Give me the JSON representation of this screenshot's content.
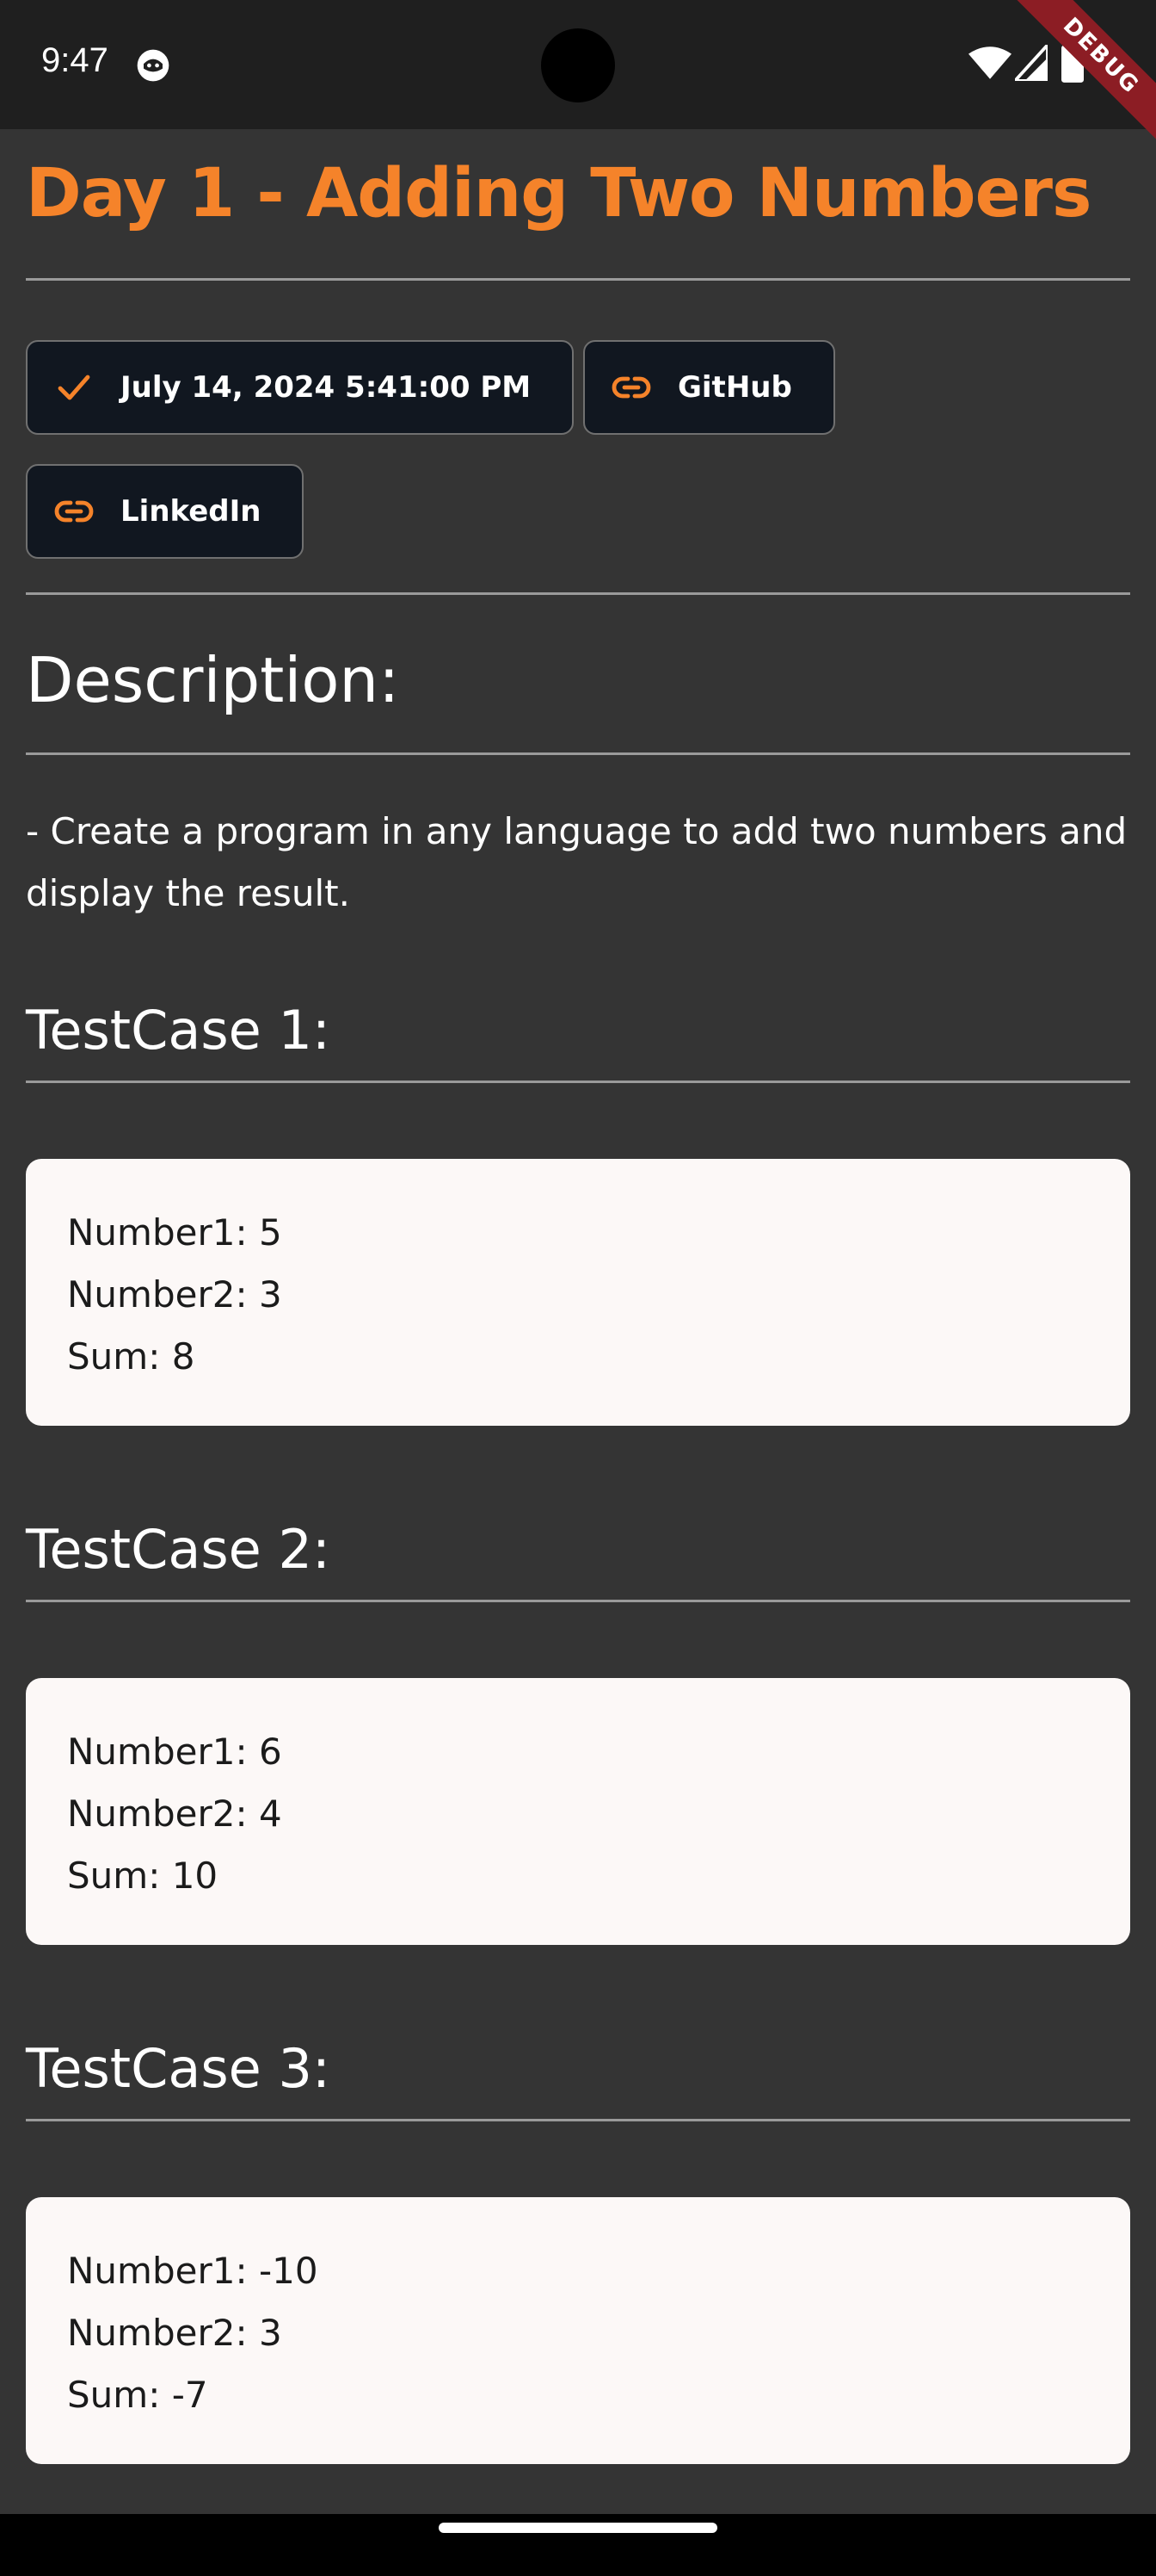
{
  "status_bar": {
    "time": "9:47"
  },
  "debug_banner": "DEBUG",
  "header": {
    "title": "Day 1 - Adding Two Numbers"
  },
  "chips": {
    "date": {
      "label": "July 14, 2024 5:41:00 PM",
      "icon": "check-icon"
    },
    "github": {
      "label": "GitHub",
      "icon": "link-icon"
    },
    "linkedin": {
      "label": "LinkedIn",
      "icon": "link-icon"
    }
  },
  "description": {
    "heading": "Description:",
    "text": "- Create a program in any language to add two numbers and display the result."
  },
  "testcases": [
    {
      "title": "TestCase 1:",
      "lines": [
        "Number1: 5",
        "Number2: 3",
        "Sum: 8"
      ]
    },
    {
      "title": "TestCase 2:",
      "lines": [
        "Number1: 6",
        "Number2: 4",
        "Sum: 10"
      ]
    },
    {
      "title": "TestCase 3:",
      "lines": [
        "Number1: -10",
        "Number2: 3",
        "Sum: -7"
      ]
    }
  ],
  "colors": {
    "accent": "#f5832a",
    "background": "#343434",
    "card": "#fcf8f7",
    "chip": "#111720"
  }
}
